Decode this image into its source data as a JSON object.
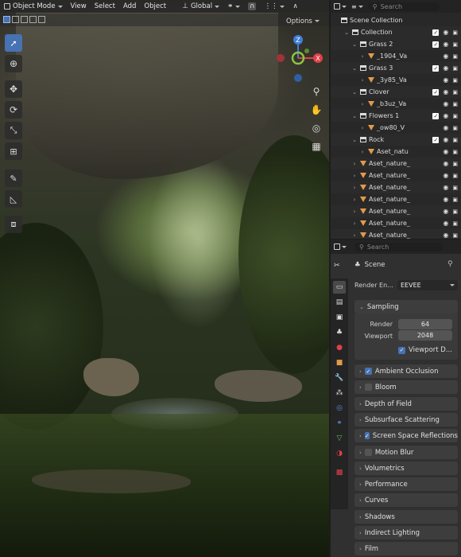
{
  "viewport_header": {
    "mode_label": "Object Mode",
    "menu": [
      "View",
      "Select",
      "Add",
      "Object"
    ],
    "transform_orientation": "Global",
    "options_label": "Options"
  },
  "outliner": {
    "search_placeholder": "Search",
    "scene_collection": "Scene Collection",
    "collection": "Collection",
    "rows": [
      {
        "label": "Grass 2",
        "kind": "collection"
      },
      {
        "label": "_1904_Va",
        "kind": "object"
      },
      {
        "label": "Grass 3",
        "kind": "collection"
      },
      {
        "label": "_3y85_Va",
        "kind": "object"
      },
      {
        "label": "Clover",
        "kind": "collection"
      },
      {
        "label": "_b3uz_Va",
        "kind": "object"
      },
      {
        "label": "Flowers 1",
        "kind": "collection"
      },
      {
        "label": "_ow80_V",
        "kind": "object"
      },
      {
        "label": "Rock",
        "kind": "collection"
      },
      {
        "label": "Aset_natu",
        "kind": "object"
      },
      {
        "label": "Aset_nature_",
        "kind": "object"
      },
      {
        "label": "Aset_nature_",
        "kind": "object"
      },
      {
        "label": "Aset_nature_",
        "kind": "object"
      },
      {
        "label": "Aset_nature_",
        "kind": "object"
      },
      {
        "label": "Aset_nature_",
        "kind": "object"
      },
      {
        "label": "Aset_nature_",
        "kind": "object"
      },
      {
        "label": "Aset_nature_",
        "kind": "object"
      }
    ]
  },
  "properties": {
    "search_placeholder": "Search",
    "context_label": "Scene",
    "render_engine_label": "Render En...",
    "render_engine_value": "EEVEE",
    "sampling": {
      "title": "Sampling",
      "render_label": "Render",
      "render_value": "64",
      "viewport_label": "Viewport",
      "viewport_value": "2048",
      "viewport_denoise": "Viewport D..."
    },
    "panels": [
      {
        "label": "Ambient Occlusion",
        "checkbox": true,
        "checked": true
      },
      {
        "label": "Bloom",
        "checkbox": true,
        "checked": false
      },
      {
        "label": "Depth of Field",
        "checkbox": false,
        "checked": false
      },
      {
        "label": "Subsurface Scattering",
        "checkbox": false,
        "checked": false
      },
      {
        "label": "Screen Space Reflections",
        "checkbox": true,
        "checked": true
      },
      {
        "label": "Motion Blur",
        "checkbox": true,
        "checked": false
      },
      {
        "label": "Volumetrics",
        "checkbox": false,
        "checked": false
      },
      {
        "label": "Performance",
        "checkbox": false,
        "checked": false
      },
      {
        "label": "Curves",
        "checkbox": false,
        "checked": false
      },
      {
        "label": "Shadows",
        "checkbox": false,
        "checked": false
      },
      {
        "label": "Indirect Lighting",
        "checkbox": false,
        "checked": false
      },
      {
        "label": "Film",
        "checkbox": false,
        "checked": false
      }
    ]
  },
  "colors": {
    "accent": "#4772b3",
    "axis_x": "#e0404a",
    "axis_y": "#8bc53f",
    "axis_z": "#3e7ed8",
    "object_icon": "#e39a4a"
  }
}
